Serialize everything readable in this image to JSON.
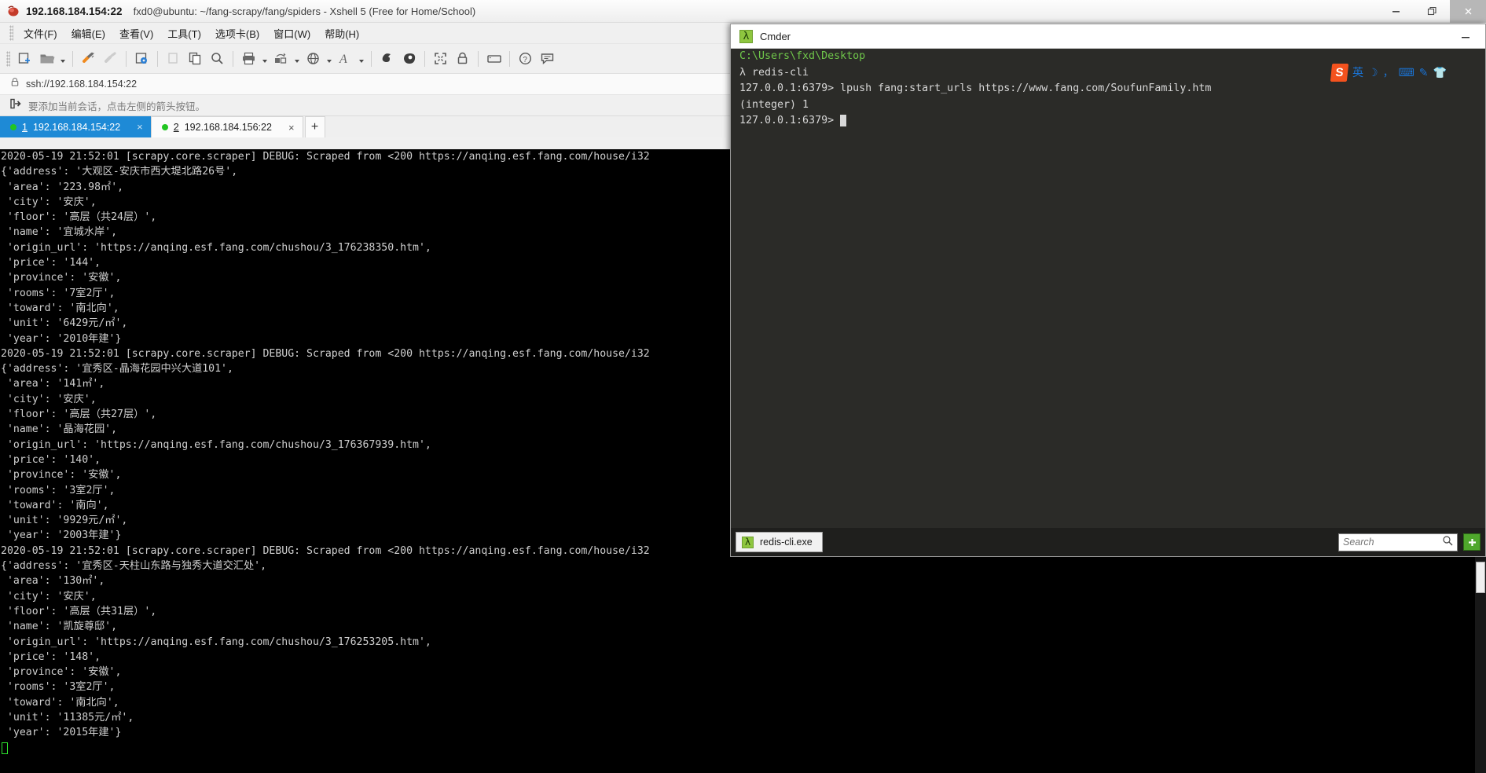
{
  "xshell": {
    "titlebar": {
      "ip": "192.168.184.154:22",
      "session": "fxd0@ubuntu: ~/fang-scrapy/fang/spiders - Xshell 5 (Free for Home/School)",
      "app_icon": "xshell-icon",
      "minimize": "minimize-icon",
      "restore": "restore-icon",
      "close": "close-icon"
    },
    "menubar": [
      {
        "label": "文件(F)",
        "name": "menu-file"
      },
      {
        "label": "编辑(E)",
        "name": "menu-edit"
      },
      {
        "label": "查看(V)",
        "name": "menu-view"
      },
      {
        "label": "工具(T)",
        "name": "menu-tools"
      },
      {
        "label": "选项卡(B)",
        "name": "menu-tabs"
      },
      {
        "label": "窗口(W)",
        "name": "menu-window"
      },
      {
        "label": "帮助(H)",
        "name": "menu-help"
      }
    ],
    "toolbar": [
      {
        "icon": "new-session-icon",
        "caret": false
      },
      {
        "icon": "open-folder-icon",
        "caret": true
      },
      {
        "sep": true
      },
      {
        "icon": "connect-icon",
        "caret": false
      },
      {
        "icon": "disconnect-icon",
        "caret": false
      },
      {
        "sep": true
      },
      {
        "icon": "session-properties-icon",
        "caret": false
      },
      {
        "sep": true
      },
      {
        "icon": "copy-session-icon",
        "caret": false
      },
      {
        "icon": "paste-icon",
        "caret": false
      },
      {
        "icon": "find-icon",
        "caret": false
      },
      {
        "sep": true
      },
      {
        "icon": "print-icon",
        "caret": true
      },
      {
        "icon": "file-transfer-icon",
        "caret": true
      },
      {
        "icon": "globe-icon",
        "caret": true
      },
      {
        "icon": "font-icon",
        "caret": true
      },
      {
        "sep": true
      },
      {
        "icon": "log-icon",
        "caret": false
      },
      {
        "icon": "highlight-icon",
        "caret": false
      },
      {
        "sep": true
      },
      {
        "icon": "fullscreen-icon",
        "caret": false
      },
      {
        "icon": "lock-icon",
        "caret": false
      },
      {
        "sep": true
      },
      {
        "icon": "keyboard-icon",
        "caret": false
      },
      {
        "sep": true
      },
      {
        "icon": "help-icon",
        "caret": false
      },
      {
        "icon": "feedback-icon",
        "caret": false
      }
    ],
    "address_bar": {
      "icon": "lock-icon",
      "value": "ssh://192.168.184.154:22"
    },
    "info_bar": {
      "icon": "add-session-icon",
      "text": "要添加当前会话，点击左侧的箭头按钮。"
    },
    "tabs": [
      {
        "num": "1",
        "label": "192.168.184.154:22",
        "active": true,
        "close": "×"
      },
      {
        "num": "2",
        "label": "192.168.184.156:22",
        "active": false,
        "close": "×"
      }
    ],
    "new_tab_label": "+",
    "terminal": {
      "lines": [
        "2020-05-19 21:52:01 [scrapy.core.scraper] DEBUG: Scraped from <200 https://anqing.esf.fang.com/house/i32",
        "{'address': '大观区-安庆市西大堤北路26号',",
        " 'area': '223.98㎡',",
        " 'city': '安庆',",
        " 'floor': '高层（共24层）',",
        " 'name': '宜城水岸',",
        " 'origin_url': 'https://anqing.esf.fang.com/chushou/3_176238350.htm',",
        " 'price': '144',",
        " 'province': '安徽',",
        " 'rooms': '7室2厅',",
        " 'toward': '南北向',",
        " 'unit': '6429元/㎡',",
        " 'year': '2010年建'}",
        "2020-05-19 21:52:01 [scrapy.core.scraper] DEBUG: Scraped from <200 https://anqing.esf.fang.com/house/i32",
        "{'address': '宜秀区-晶海花园中兴大道101',",
        " 'area': '141㎡',",
        " 'city': '安庆',",
        " 'floor': '高层（共27层）',",
        " 'name': '晶海花园',",
        " 'origin_url': 'https://anqing.esf.fang.com/chushou/3_176367939.htm',",
        " 'price': '140',",
        " 'province': '安徽',",
        " 'rooms': '3室2厅',",
        " 'toward': '南向',",
        " 'unit': '9929元/㎡',",
        " 'year': '2003年建'}",
        "2020-05-19 21:52:01 [scrapy.core.scraper] DEBUG: Scraped from <200 https://anqing.esf.fang.com/house/i32",
        "{'address': '宜秀区-天柱山东路与独秀大道交汇处',",
        " 'area': '130㎡',",
        " 'city': '安庆',",
        " 'floor': '高层（共31层）',",
        " 'name': '凯旋尊邸',",
        " 'origin_url': 'https://anqing.esf.fang.com/chushou/3_176253205.htm',",
        " 'price': '148',",
        " 'province': '安徽',",
        " 'rooms': '3室2厅',",
        " 'toward': '南北向',",
        " 'unit': '11385元/㎡',",
        " 'year': '2015年建'}"
      ]
    }
  },
  "cmder": {
    "titlebar": {
      "icon": "lambda-icon",
      "title": "Cmder",
      "minimize": "minimize-icon"
    },
    "terminal": {
      "lines": [
        {
          "text": "C:\\Users\\fxd\\Desktop",
          "color": "green"
        },
        {
          "text": "λ redis-cli",
          "color": "normal"
        },
        {
          "text": "127.0.0.1:6379> lpush fang:start_urls https://www.fang.com/SoufunFamily.htm",
          "color": "normal"
        },
        {
          "text": "(integer) 1",
          "color": "normal"
        },
        {
          "text": "127.0.0.1:6379> ",
          "color": "normal",
          "cursor": true
        }
      ]
    },
    "statusbar": {
      "tab": {
        "icon": "lambda-icon",
        "label": "redis-cli.exe"
      },
      "search_placeholder": "Search",
      "search_icon": "search-icon",
      "new_tab_icon": "plus-icon"
    }
  },
  "ime": {
    "logo": "S",
    "items": [
      {
        "glyph": "英",
        "name": "ime-mode-english"
      },
      {
        "glyph": "☽",
        "name": "ime-moon-icon"
      },
      {
        "glyph": "，",
        "name": "ime-punctuation-icon"
      },
      {
        "glyph": "⌨",
        "name": "ime-keyboard-icon"
      },
      {
        "glyph": "✎",
        "name": "ime-handwriting-icon"
      },
      {
        "glyph": "👕",
        "name": "ime-skin-icon"
      }
    ]
  },
  "colors": {
    "xshell_accent": "#1e8ad6",
    "cmder_bg": "#2b2b28",
    "cmder_green": "#6fc64a",
    "terminal_bg": "#000000",
    "terminal_fg": "#cfcfcf",
    "cursor_green": "#2ee62e",
    "ime_orange": "#f4521e"
  }
}
